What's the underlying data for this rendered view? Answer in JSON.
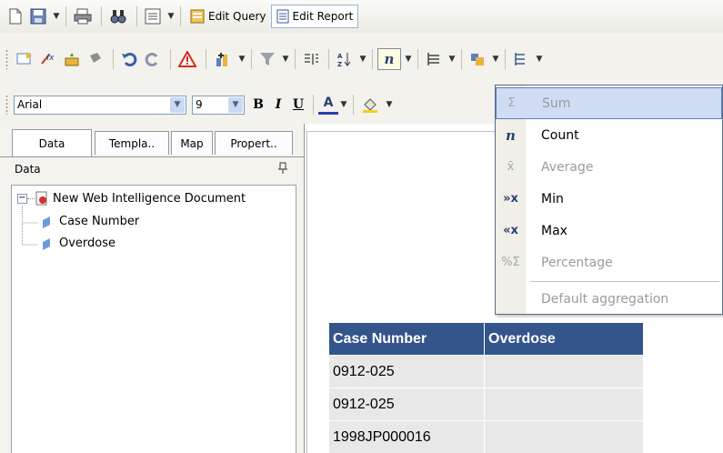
{
  "toolbar1": {
    "edit_query": "Edit Query",
    "edit_report": "Edit Report"
  },
  "formatbar": {
    "font_name": "Arial",
    "font_size": "9",
    "bold": "B",
    "italic": "I",
    "underline": "U",
    "font_color": "A"
  },
  "left_panel": {
    "tabs": [
      "Data",
      "Templa..",
      "Map",
      "Propert.."
    ],
    "active_tab": "Data",
    "panel_title": "Data",
    "pin_glyph": "ф",
    "tree": {
      "root": "New Web Intelligence Document",
      "children": [
        "Case Number",
        "Overdose"
      ]
    }
  },
  "aggregate_menu": {
    "button_glyph": "n",
    "items": [
      {
        "label": "Sum",
        "enabled": false,
        "highlighted": true,
        "icon": "sum-icon"
      },
      {
        "label": "Count",
        "enabled": true,
        "highlighted": false,
        "icon": "count-icon"
      },
      {
        "label": "Average",
        "enabled": false,
        "highlighted": false,
        "icon": "average-icon"
      },
      {
        "label": "Min",
        "enabled": true,
        "highlighted": false,
        "icon": "min-icon"
      },
      {
        "label": "Max",
        "enabled": true,
        "highlighted": false,
        "icon": "max-icon"
      },
      {
        "label": "Percentage",
        "enabled": false,
        "highlighted": false,
        "icon": "percentage-icon"
      }
    ],
    "default_item": "Default aggregation"
  },
  "report_table": {
    "headers": [
      "Case Number",
      "Overdose"
    ],
    "rows": [
      [
        "0912-025",
        ""
      ],
      [
        "0912-025",
        ""
      ],
      [
        "1998JP000016",
        ""
      ]
    ]
  },
  "colors": {
    "table_header": "#34558c",
    "table_cell": "#e8e8e8",
    "menu_highlight": "#cfdcf4"
  }
}
